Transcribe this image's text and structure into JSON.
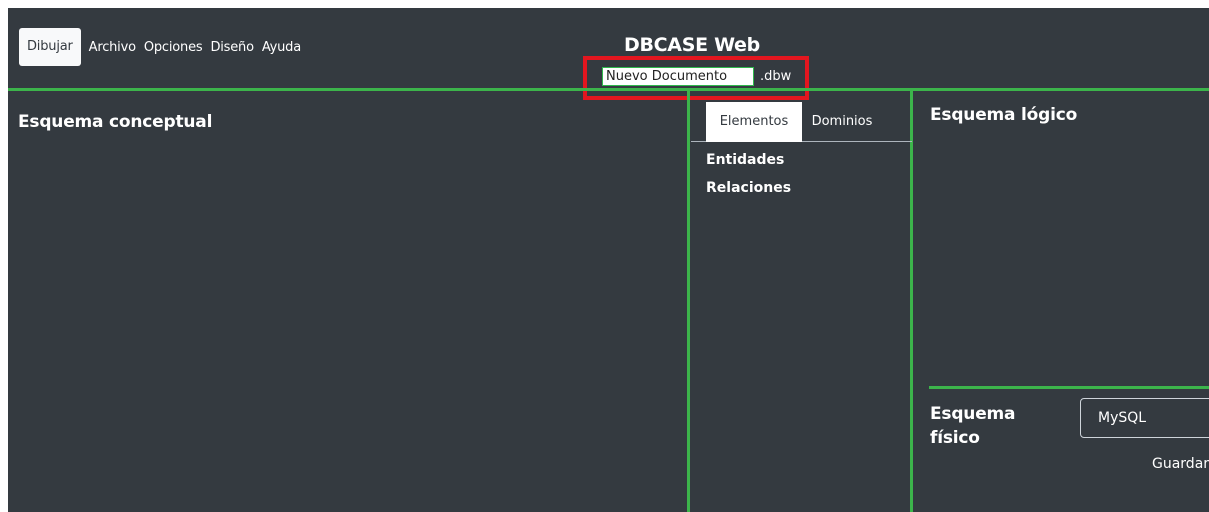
{
  "header": {
    "menu": [
      "Dibujar",
      "Archivo",
      "Opciones",
      "Diseño",
      "Ayuda"
    ],
    "app_title": "DBCASE Web",
    "document_name": "Nuevo Documento",
    "document_extension": ".dbw"
  },
  "conceptual": {
    "title": "Esquema conceptual"
  },
  "palette": {
    "tabs": [
      "Elementos",
      "Dominios"
    ],
    "active_tab": "Elementos",
    "items": [
      "Entidades",
      "Relaciones"
    ]
  },
  "logical": {
    "title": "Esquema lógico"
  },
  "physical": {
    "title": "Esquema físico",
    "db_selected": "MySQL",
    "save_label": "Guardar"
  },
  "colors": {
    "background": "#343a40",
    "divider": "#3cb44b",
    "highlight": "#e3161f"
  }
}
